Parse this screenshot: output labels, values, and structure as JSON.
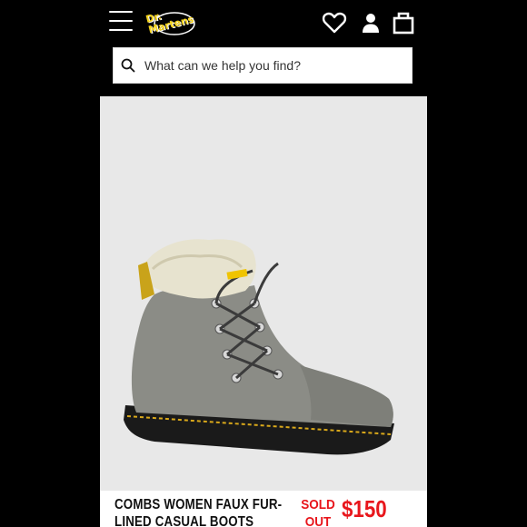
{
  "brand": {
    "logo_text": "Dr.\nMartens",
    "logo_color": "#f3d21c"
  },
  "header": {
    "menu_icon": "hamburger-menu-icon",
    "wishlist_icon": "heart-icon",
    "account_icon": "user-icon",
    "cart_icon": "shopping-bag-icon",
    "background": "#000000"
  },
  "search": {
    "placeholder": "What can we help you find?",
    "icon": "search-icon"
  },
  "product": {
    "title": "COMBS WOMEN FAUX FUR-\nLINED CASUAL BOOTS",
    "status": "SOLD\nOUT",
    "price": "$150",
    "accent_color": "#e8161c",
    "image_background": "#e8e8e8"
  }
}
